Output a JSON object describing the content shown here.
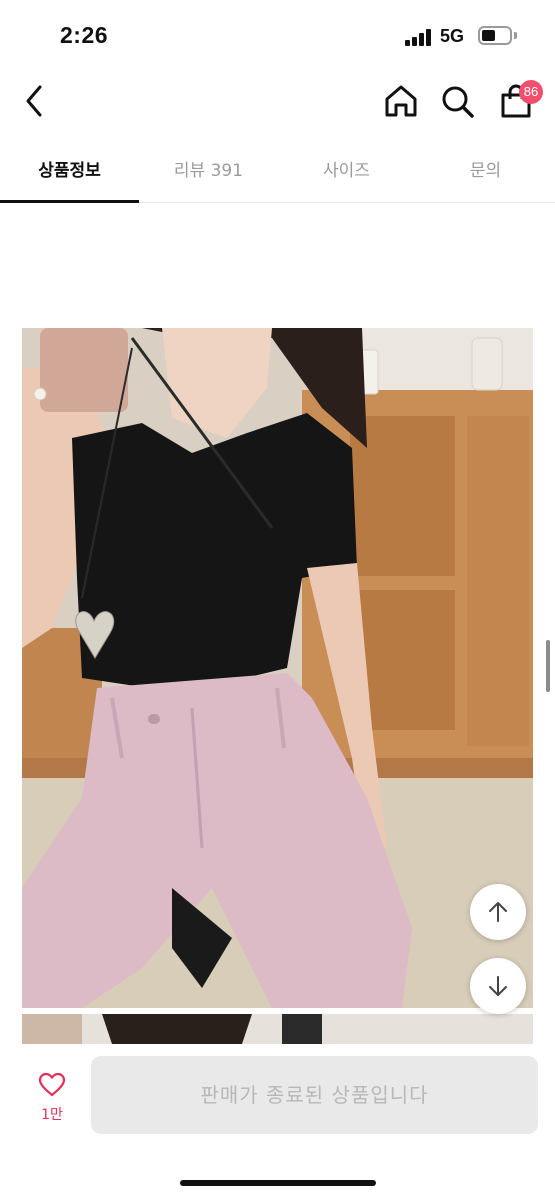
{
  "status_bar": {
    "time": "2:26",
    "network": "5G"
  },
  "nav": {
    "back_icon": "chevron-left-icon",
    "home_icon": "home-icon",
    "search_icon": "search-icon",
    "cart_icon": "shopping-bag-icon",
    "cart_count": "86"
  },
  "tabs": [
    {
      "label": "상품정보",
      "active": true
    },
    {
      "label": "리뷰 391",
      "active": false
    },
    {
      "label": "사이즈",
      "active": false
    },
    {
      "label": "문의",
      "active": false
    }
  ],
  "scroll_buttons": {
    "up_icon": "arrow-up-icon",
    "down_icon": "arrow-down-icon"
  },
  "bottom": {
    "like_icon": "heart-icon",
    "like_count": "1만",
    "soldout_label": "판매가 종료된 상품입니다"
  },
  "colors": {
    "accent": "#e0315a",
    "badge": "#f0506e",
    "disabled_bg": "#e9e9e9",
    "disabled_text": "#b7b7b7",
    "tab_inactive": "#9b9b9b"
  }
}
